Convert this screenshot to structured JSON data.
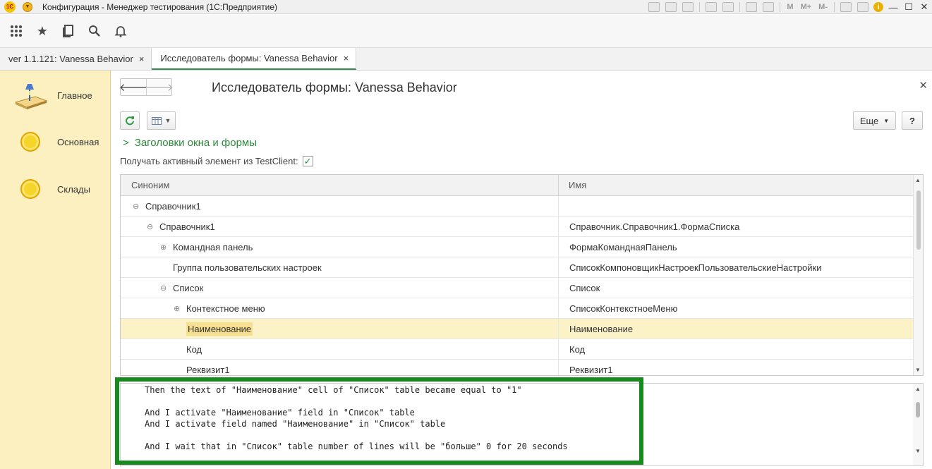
{
  "window": {
    "logo": "1С",
    "title": "Конфигурация - Менеджер тестирования (1С:Предприятие)",
    "m_buttons": [
      "M",
      "M+",
      "M-"
    ],
    "info_symbol": "i",
    "minimize": "—",
    "maximize": "☐",
    "close": "✕"
  },
  "tabs": [
    {
      "label": "ver 1.1.121: Vanessa Behavior",
      "close": "×"
    },
    {
      "label": "Исследователь формы: Vanessa Behavior",
      "close": "×"
    }
  ],
  "sidebar": {
    "items": [
      {
        "label": "Главное",
        "icon": "desk-lamp-icon"
      },
      {
        "label": "Основная",
        "icon": "sun-icon"
      },
      {
        "label": "Склады",
        "icon": "sun-icon"
      }
    ]
  },
  "form": {
    "title": "Исследователь формы: Vanessa Behavior",
    "more_button": "Еще",
    "help_button": "?",
    "group_header": "Заголовки окна и формы",
    "checkbox_label": "Получать активный элемент из TestClient:",
    "checkbox_checked": true
  },
  "grid": {
    "columns": [
      "Синоним",
      "Имя"
    ],
    "rows": [
      {
        "synonym": "Справочник1",
        "name": "",
        "level": 0,
        "expander": "⊖"
      },
      {
        "synonym": "Справочник1",
        "name": "Справочник.Справочник1.ФормаСписка",
        "level": 1,
        "expander": "⊖"
      },
      {
        "synonym": "Командная панель",
        "name": "ФормаКоманднаяПанель",
        "level": 2,
        "expander": "⊕"
      },
      {
        "synonym": "Группа пользовательских настроек",
        "name": "СписокКомпоновщикНастроекПользовательскиеНастройки",
        "level": 2,
        "expander": ""
      },
      {
        "synonym": "Список",
        "name": "Список",
        "level": 2,
        "expander": "⊖"
      },
      {
        "synonym": "Контекстное меню",
        "name": "СписокКонтекстноеМеню",
        "level": 3,
        "expander": "⊕"
      },
      {
        "synonym": "Наименование",
        "name": "Наименование",
        "level": 4,
        "expander": "",
        "selected": true
      },
      {
        "synonym": "Код",
        "name": "Код",
        "level": 4,
        "expander": ""
      },
      {
        "synonym": "Реквизит1",
        "name": "Реквизит1",
        "level": 4,
        "expander": ""
      }
    ]
  },
  "script_lines": [
    "Then the text of \"Наименование\" cell of \"Список\" table became equal to \"1\"",
    "",
    "And I activate \"Наименование\" field in \"Список\" table",
    "And I activate field named \"Наименование\" in \"Список\" table",
    "",
    "And I wait that in \"Список\" table number of lines will be \"больше\" 0 for 20 seconds"
  ],
  "colors": {
    "accent_green": "#2a8c3a",
    "highlight_frame": "#168a1c",
    "sidebar_bg": "#fcf0c0",
    "selected_row": "#fbf2c7"
  }
}
